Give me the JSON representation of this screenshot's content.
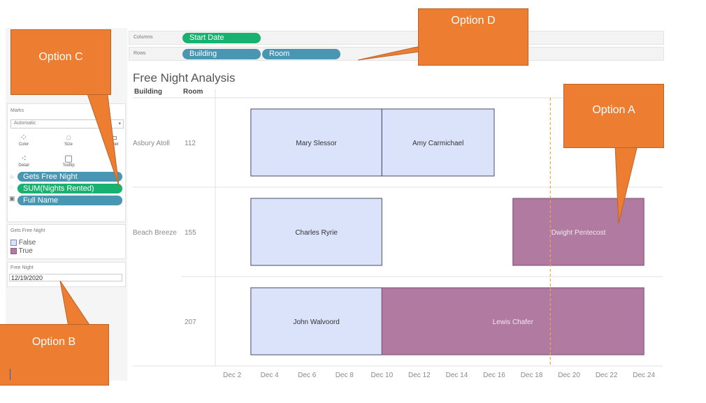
{
  "shelves": {
    "columns_label": "Columns",
    "rows_label": "Rows",
    "columns_pills": [
      "Start Date"
    ],
    "rows_pills": [
      "Building",
      "Room"
    ]
  },
  "marks": {
    "title": "Marks",
    "type": "Automatic",
    "buttons": [
      {
        "label": "Color",
        "icon": "color-icon"
      },
      {
        "label": "Size",
        "icon": "size-icon"
      },
      {
        "label": "Label",
        "icon": "label-icon"
      },
      {
        "label": "Detail",
        "icon": "detail-icon"
      },
      {
        "label": "Tooltip",
        "icon": "tooltip-icon"
      }
    ],
    "fields": [
      "Gets Free Night",
      "SUM(Nights Rented)",
      "Full Name"
    ]
  },
  "legend": {
    "title": "Gets Free Night",
    "items": [
      {
        "label": "False",
        "color": "#dbe3fb"
      },
      {
        "label": "True",
        "color": "#b07aa1"
      }
    ]
  },
  "parameter": {
    "title": "Free Night",
    "value": "12/19/2020"
  },
  "view": {
    "title": "Free Night Analysis",
    "col_header_building": "Building",
    "col_header_room": "Room"
  },
  "callouts": {
    "a": "Option A",
    "b": "Option B",
    "c": "Option C",
    "d": "Option D"
  },
  "colors": {
    "false": "#dbe3fb",
    "true": "#b07aa1",
    "callout": "#ed7d31",
    "teal_pill": "#4996b2",
    "green_pill": "#17b26f",
    "ref_line": "#f0a25a"
  },
  "chart_data": {
    "type": "gantt",
    "title": "Free Night Analysis",
    "x_axis": {
      "unit": "date",
      "ticks": [
        "Dec 2",
        "Dec 4",
        "Dec 6",
        "Dec 8",
        "Dec 10",
        "Dec 12",
        "Dec 14",
        "Dec 16",
        "Dec 18",
        "Dec 20",
        "Dec 22",
        "Dec 24"
      ],
      "range": [
        1.1,
        25.0
      ]
    },
    "rows": [
      {
        "building": "Asbury Atoll",
        "room": "112"
      },
      {
        "building": "Beach Breeze",
        "room": "155"
      },
      {
        "building": "",
        "room": "207"
      }
    ],
    "bars": [
      {
        "row": 0,
        "name": "Mary Slessor",
        "start": 3,
        "end": 10,
        "free_night": false
      },
      {
        "row": 0,
        "name": "Amy Carmichael",
        "start": 10,
        "end": 16,
        "free_night": false
      },
      {
        "row": 1,
        "name": "Charles Ryrie",
        "start": 3,
        "end": 10,
        "free_night": false
      },
      {
        "row": 1,
        "name": "Dwight Pentecost",
        "start": 17,
        "end": 24,
        "free_night": true
      },
      {
        "row": 2,
        "name": "John Walvoord",
        "start": 3,
        "end": 10,
        "free_night": false
      },
      {
        "row": 2,
        "name": "Lewis Chafer",
        "start": 10,
        "end": 24,
        "free_night": true
      }
    ],
    "reference_line": {
      "value": 19,
      "label": "12/19/2020"
    },
    "legend": {
      "title": "Gets Free Night",
      "entries": [
        "False",
        "True"
      ]
    }
  }
}
